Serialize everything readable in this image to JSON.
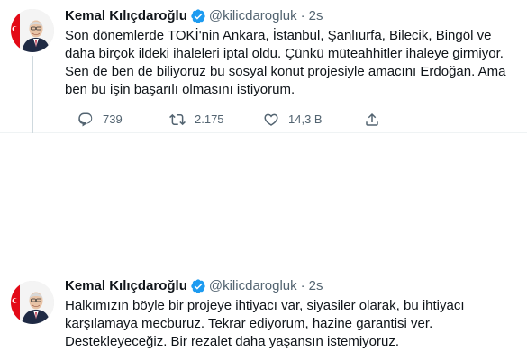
{
  "tweets": [
    {
      "author": {
        "name": "Kemal Kılıçdaroğlu",
        "handle": "@kilicdarogluk"
      },
      "time": "2s",
      "text": "Son dönemlerde TOKİ'nin Ankara, İstanbul, Şanlıurfa, Bilecik, Bingöl ve daha birçok ildeki ihaleleri iptal oldu. Çünkü müteahhitler ihaleye girmiyor. Sen de ben de biliyoruz bu sosyal konut projesiyle amacını Erdoğan. Ama ben bu işin başarılı olmasını istiyorum.",
      "stats": {
        "replies": "739",
        "retweets": "2.175",
        "likes": "14,3 B"
      }
    },
    {
      "author": {
        "name": "Kemal Kılıçdaroğlu",
        "handle": "@kilicdarogluk"
      },
      "time": "2s",
      "text": "Halkımızın böyle bir projeye ihtiyacı var, siyasiler olarak, bu ihtiyacı karşılamaya mecburuz. Tekrar ediyorum, hazine garantisi ver. Destekleyeceğiz. Bir rezalet daha yaşansın istemiyoruz."
    }
  ],
  "colors": {
    "verified": "#1d9bf0",
    "text": "#0f1419",
    "secondary": "#536471",
    "thread_line": "#cfd9de"
  },
  "icons": [
    "reply-icon",
    "retweet-icon",
    "like-icon",
    "share-icon",
    "verified-badge-icon"
  ]
}
